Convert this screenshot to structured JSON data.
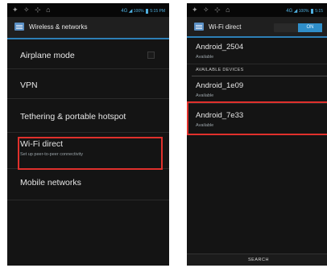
{
  "left": {
    "status": {
      "left_icons": "✦ ✧ ⊹ ⌂",
      "network": "4G",
      "battery": "100%",
      "time": "5:15",
      "ampm": "PM"
    },
    "title": "Wireless & networks",
    "items": [
      {
        "label": "Airplane mode",
        "sub": ""
      },
      {
        "label": "VPN",
        "sub": ""
      },
      {
        "label": "Tethering & portable hotspot",
        "sub": ""
      },
      {
        "label": "Wi-Fi direct",
        "sub": "Set up peer-to-peer connectivity"
      },
      {
        "label": "Mobile networks",
        "sub": ""
      }
    ]
  },
  "right": {
    "status": {
      "left_icons": "✦ ✧ ⊹ ⌂",
      "network": "4G",
      "battery": "100%",
      "time": "5:15"
    },
    "title": "Wi-Fi direct",
    "toggle": "ON",
    "connected": {
      "name": "Android_2504",
      "status": "Available"
    },
    "section": "AVAILABLE DEVICES",
    "devices": [
      {
        "name": "Android_1e09",
        "status": "Available"
      },
      {
        "name": "Android_7e33",
        "status": "Available"
      }
    ],
    "search": "SEARCH"
  },
  "colors": {
    "accent": "#2d7fb6",
    "highlight": "#e0302c",
    "background": "#141414"
  }
}
